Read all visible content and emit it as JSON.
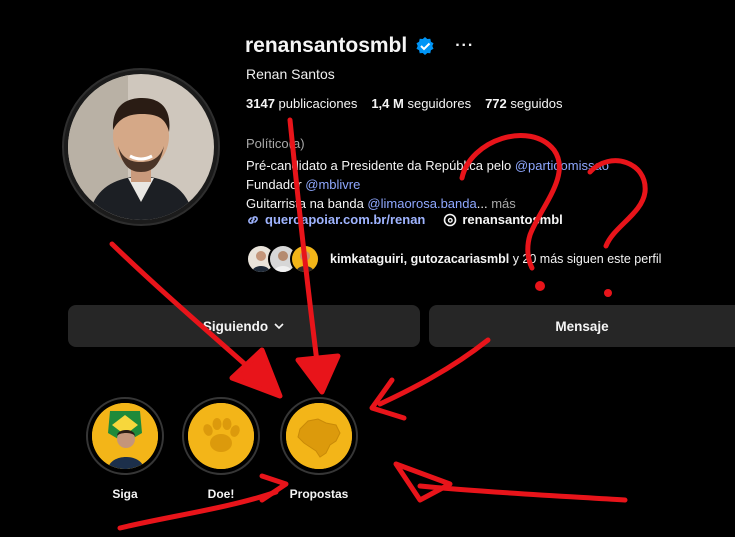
{
  "profile": {
    "username": "renansantosmbl",
    "full_name": "Renan Santos",
    "stats": {
      "posts_value": "3147",
      "posts_label": "publicaciones",
      "followers_value": "1,4 M",
      "followers_label": "seguidores",
      "following_value": "772",
      "following_label": "seguidos"
    },
    "category": "Político(a)",
    "bio": {
      "line1_text": "Pré-candidato a Presidente da República pelo ",
      "line1_link": "@partidomissao",
      "line2_text": "Fundador ",
      "line2_link": "@mblivre",
      "line3_text": "Guitarrista na banda ",
      "line3_link": "@limaorosa.banda",
      "line3_more_dots": "... ",
      "line3_more": "más"
    },
    "external_link": "queroapoiar.com.br/renan",
    "threads_handle": "renansantosmbl",
    "followed_by": {
      "names": "kimkataguiri, gutozacariasmbl",
      "rest": " y 20 más siguen este perfil"
    }
  },
  "buttons": {
    "following": "Siguiendo",
    "message": "Mensaje"
  },
  "highlights": [
    {
      "label": "Siga"
    },
    {
      "label": "Doe!"
    },
    {
      "label": "Propostas"
    }
  ],
  "annotations": {
    "color": "#e8141a",
    "marks": [
      "?",
      "?"
    ]
  },
  "icons": {
    "verified": "verified-badge-icon",
    "more": "more-options-icon",
    "link": "link-icon",
    "threads": "threads-icon",
    "chevron": "chevron-down-icon"
  }
}
